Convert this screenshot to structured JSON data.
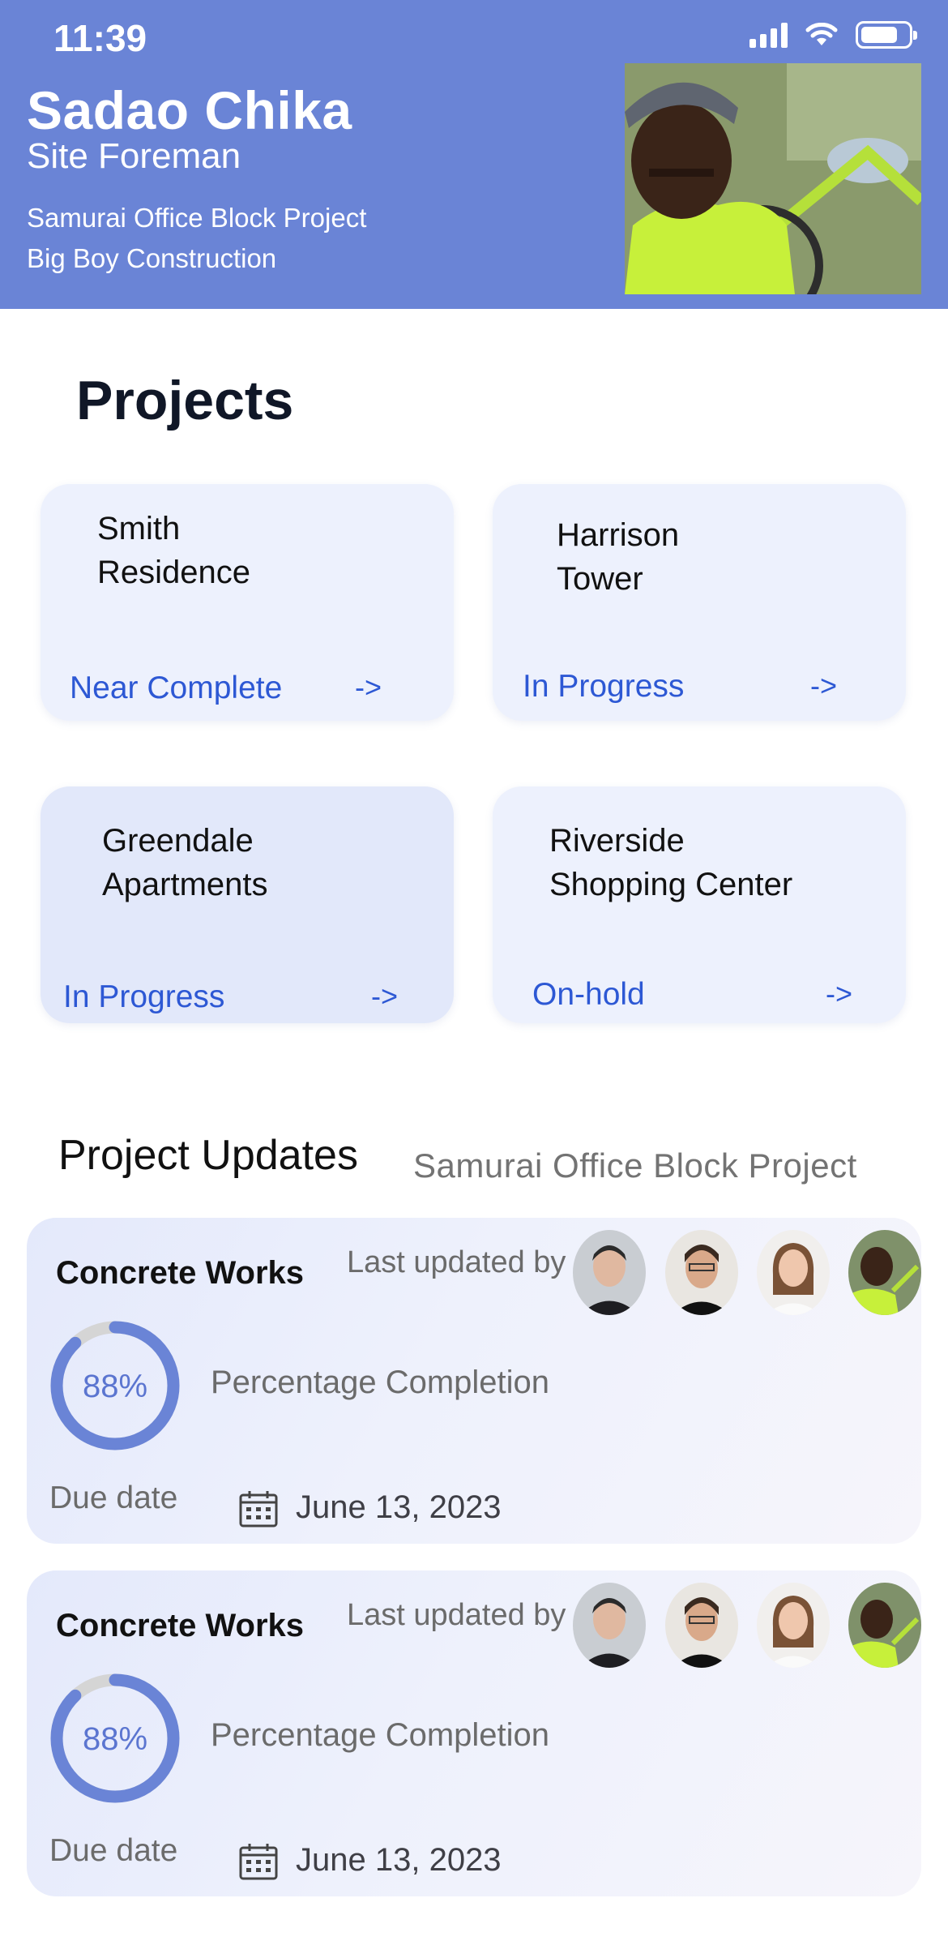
{
  "status_bar": {
    "time": "11:39"
  },
  "user": {
    "name": "Sadao Chika",
    "role": "Site Foreman",
    "project": "Samurai Office Block Project",
    "company": "Big Boy Construction"
  },
  "projects": {
    "title": "Projects",
    "cards": [
      {
        "name_line1": "Smith",
        "name_line2": "Residence",
        "status": "Near Complete",
        "arrow": "->"
      },
      {
        "name_line1": "Harrison",
        "name_line2": "Tower",
        "status": "In Progress",
        "arrow": "->"
      },
      {
        "name_line1": "Greendale",
        "name_line2": "Apartments",
        "status": "In Progress",
        "arrow": "->"
      },
      {
        "name_line1": "Riverside",
        "name_line2": "Shopping Center",
        "status": "On-hold",
        "arrow": "->"
      }
    ]
  },
  "updates": {
    "title": "Project Updates",
    "project_name": "Samurai Office Block  Project",
    "items": [
      {
        "task": "Concrete Works",
        "updated_by_label": "Last updated by",
        "progress": 0.88,
        "progress_text": "88%",
        "progress_label": "Percentage Completion",
        "due_label": "Due date",
        "due_date": "June 13, 2023"
      },
      {
        "task": "Concrete Works",
        "updated_by_label": "Last updated by",
        "progress": 0.88,
        "progress_text": "88%",
        "progress_label": "Percentage Completion",
        "due_label": "Due date",
        "due_date": "June 13, 2023"
      }
    ]
  },
  "colors": {
    "header": "#6a84d6",
    "accent_blue": "#2d58d4",
    "ring": "#6a84d6",
    "ring_track": "#d5d5d5"
  }
}
